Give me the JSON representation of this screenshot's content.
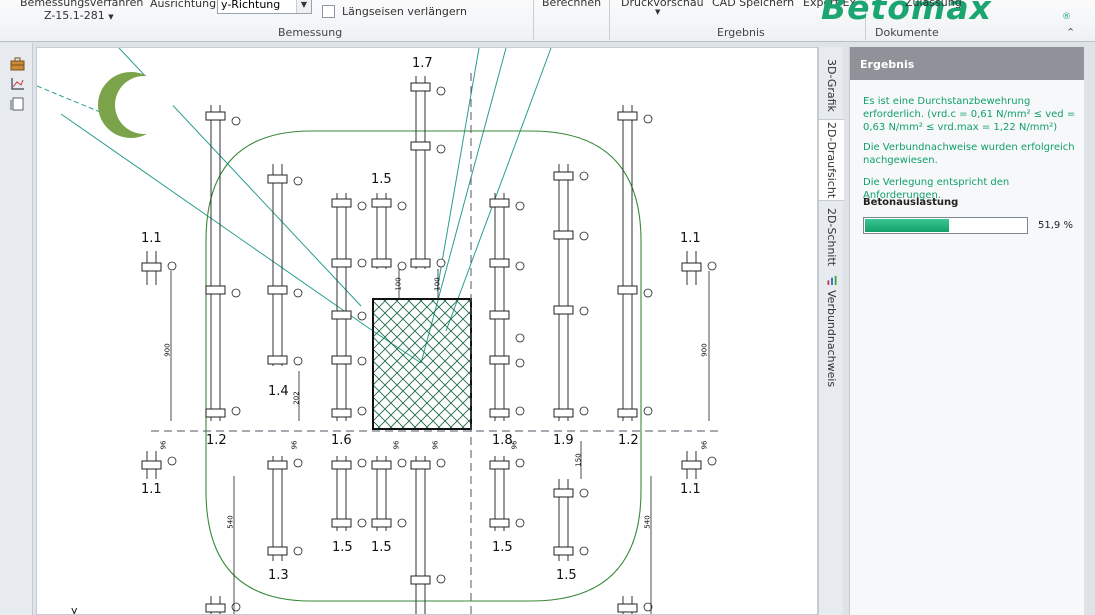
{
  "ribbon": {
    "bemessungsverfahren_label": "Bemessungsverfahren",
    "bemessungsverfahren_value": "Z-15.1-281",
    "ausrichtung_label": "Ausrichtung",
    "ausrichtung_value": "y-Richtung",
    "laengseisen_label": "Längseisen verlängern",
    "group_bemessung": "Bemessung",
    "berechnen_label": "Berechnen",
    "druckvorschau_label": "Druckvorschau",
    "cad_label": "CAD Speichern",
    "export_label": "Export Ex",
    "zulassung_label": "Zulassung",
    "group_ergebnis": "Ergebnis",
    "group_dokumente": "Dokumente",
    "logo_text": "Betomax",
    "logo_reg": "®",
    "brand_color": "#1aa571"
  },
  "left_strip": {
    "icons": [
      "toolbox-icon",
      "chart-axis-icon",
      "page-icon"
    ]
  },
  "drawing": {
    "labels": [
      "1.7",
      "1.5",
      "1.1",
      "1.1",
      "1.4",
      "1.2",
      "1.6",
      "1.8",
      "1.9",
      "1.2",
      "1.1",
      "1.1",
      "1.5",
      "1.5",
      "1.5",
      "1.3",
      "1.5"
    ],
    "dims": [
      "900",
      "900",
      "540",
      "540",
      "150",
      "150",
      "100",
      "100",
      "202",
      "96",
      "96",
      "96",
      "96",
      "96",
      "96"
    ],
    "marker": "1",
    "axis_label": "y"
  },
  "vtabs": [
    "3D-Grafik",
    "2D-Draufsicht",
    "2D-Schnitt",
    "Verbundnachweis"
  ],
  "panel": {
    "header": "Ergebnis",
    "msg1": "Es ist eine Durchstanzbewehrung erforderlich. (vrd.c = 0,61 N/mm² ≤ ved = 0,63 N/mm² ≤ vrd.max = 1,22 N/mm²)",
    "msg2": "Die Verbundnachweise wurden erfolgreich nachgewiesen.",
    "msg3": "Die Verlegung entspricht den Anforderungen.",
    "util_title": "Betonauslastung",
    "util_value_text": "51,9 %",
    "util_fraction": 0.519,
    "accent_color": "#12a06b"
  }
}
